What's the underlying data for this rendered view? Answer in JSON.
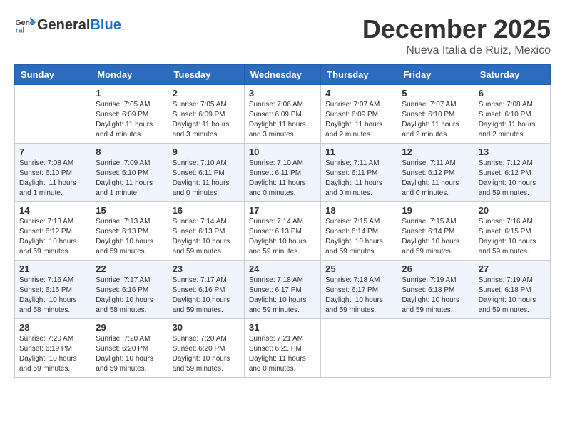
{
  "logo": {
    "general": "General",
    "blue": "Blue"
  },
  "header": {
    "month": "December 2025",
    "location": "Nueva Italia de Ruiz, Mexico"
  },
  "days_of_week": [
    "Sunday",
    "Monday",
    "Tuesday",
    "Wednesday",
    "Thursday",
    "Friday",
    "Saturday"
  ],
  "weeks": [
    [
      {
        "day": "",
        "info": ""
      },
      {
        "day": "1",
        "info": "Sunrise: 7:05 AM\nSunset: 6:09 PM\nDaylight: 11 hours\nand 4 minutes."
      },
      {
        "day": "2",
        "info": "Sunrise: 7:05 AM\nSunset: 6:09 PM\nDaylight: 11 hours\nand 3 minutes."
      },
      {
        "day": "3",
        "info": "Sunrise: 7:06 AM\nSunset: 6:09 PM\nDaylight: 11 hours\nand 3 minutes."
      },
      {
        "day": "4",
        "info": "Sunrise: 7:07 AM\nSunset: 6:09 PM\nDaylight: 11 hours\nand 2 minutes."
      },
      {
        "day": "5",
        "info": "Sunrise: 7:07 AM\nSunset: 6:10 PM\nDaylight: 11 hours\nand 2 minutes."
      },
      {
        "day": "6",
        "info": "Sunrise: 7:08 AM\nSunset: 6:10 PM\nDaylight: 11 hours\nand 2 minutes."
      }
    ],
    [
      {
        "day": "7",
        "info": "Sunrise: 7:08 AM\nSunset: 6:10 PM\nDaylight: 11 hours\nand 1 minute."
      },
      {
        "day": "8",
        "info": "Sunrise: 7:09 AM\nSunset: 6:10 PM\nDaylight: 11 hours\nand 1 minute."
      },
      {
        "day": "9",
        "info": "Sunrise: 7:10 AM\nSunset: 6:11 PM\nDaylight: 11 hours\nand 0 minutes."
      },
      {
        "day": "10",
        "info": "Sunrise: 7:10 AM\nSunset: 6:11 PM\nDaylight: 11 hours\nand 0 minutes."
      },
      {
        "day": "11",
        "info": "Sunrise: 7:11 AM\nSunset: 6:11 PM\nDaylight: 11 hours\nand 0 minutes."
      },
      {
        "day": "12",
        "info": "Sunrise: 7:11 AM\nSunset: 6:12 PM\nDaylight: 11 hours\nand 0 minutes."
      },
      {
        "day": "13",
        "info": "Sunrise: 7:12 AM\nSunset: 6:12 PM\nDaylight: 10 hours\nand 59 minutes."
      }
    ],
    [
      {
        "day": "14",
        "info": "Sunrise: 7:13 AM\nSunset: 6:12 PM\nDaylight: 10 hours\nand 59 minutes."
      },
      {
        "day": "15",
        "info": "Sunrise: 7:13 AM\nSunset: 6:13 PM\nDaylight: 10 hours\nand 59 minutes."
      },
      {
        "day": "16",
        "info": "Sunrise: 7:14 AM\nSunset: 6:13 PM\nDaylight: 10 hours\nand 59 minutes."
      },
      {
        "day": "17",
        "info": "Sunrise: 7:14 AM\nSunset: 6:13 PM\nDaylight: 10 hours\nand 59 minutes."
      },
      {
        "day": "18",
        "info": "Sunrise: 7:15 AM\nSunset: 6:14 PM\nDaylight: 10 hours\nand 59 minutes."
      },
      {
        "day": "19",
        "info": "Sunrise: 7:15 AM\nSunset: 6:14 PM\nDaylight: 10 hours\nand 59 minutes."
      },
      {
        "day": "20",
        "info": "Sunrise: 7:16 AM\nSunset: 6:15 PM\nDaylight: 10 hours\nand 59 minutes."
      }
    ],
    [
      {
        "day": "21",
        "info": "Sunrise: 7:16 AM\nSunset: 6:15 PM\nDaylight: 10 hours\nand 58 minutes."
      },
      {
        "day": "22",
        "info": "Sunrise: 7:17 AM\nSunset: 6:16 PM\nDaylight: 10 hours\nand 58 minutes."
      },
      {
        "day": "23",
        "info": "Sunrise: 7:17 AM\nSunset: 6:16 PM\nDaylight: 10 hours\nand 59 minutes."
      },
      {
        "day": "24",
        "info": "Sunrise: 7:18 AM\nSunset: 6:17 PM\nDaylight: 10 hours\nand 59 minutes."
      },
      {
        "day": "25",
        "info": "Sunrise: 7:18 AM\nSunset: 6:17 PM\nDaylight: 10 hours\nand 59 minutes."
      },
      {
        "day": "26",
        "info": "Sunrise: 7:19 AM\nSunset: 6:18 PM\nDaylight: 10 hours\nand 59 minutes."
      },
      {
        "day": "27",
        "info": "Sunrise: 7:19 AM\nSunset: 6:18 PM\nDaylight: 10 hours\nand 59 minutes."
      }
    ],
    [
      {
        "day": "28",
        "info": "Sunrise: 7:20 AM\nSunset: 6:19 PM\nDaylight: 10 hours\nand 59 minutes."
      },
      {
        "day": "29",
        "info": "Sunrise: 7:20 AM\nSunset: 6:20 PM\nDaylight: 10 hours\nand 59 minutes."
      },
      {
        "day": "30",
        "info": "Sunrise: 7:20 AM\nSunset: 6:20 PM\nDaylight: 10 hours\nand 59 minutes."
      },
      {
        "day": "31",
        "info": "Sunrise: 7:21 AM\nSunset: 6:21 PM\nDaylight: 11 hours\nand 0 minutes."
      },
      {
        "day": "",
        "info": ""
      },
      {
        "day": "",
        "info": ""
      },
      {
        "day": "",
        "info": ""
      }
    ]
  ]
}
